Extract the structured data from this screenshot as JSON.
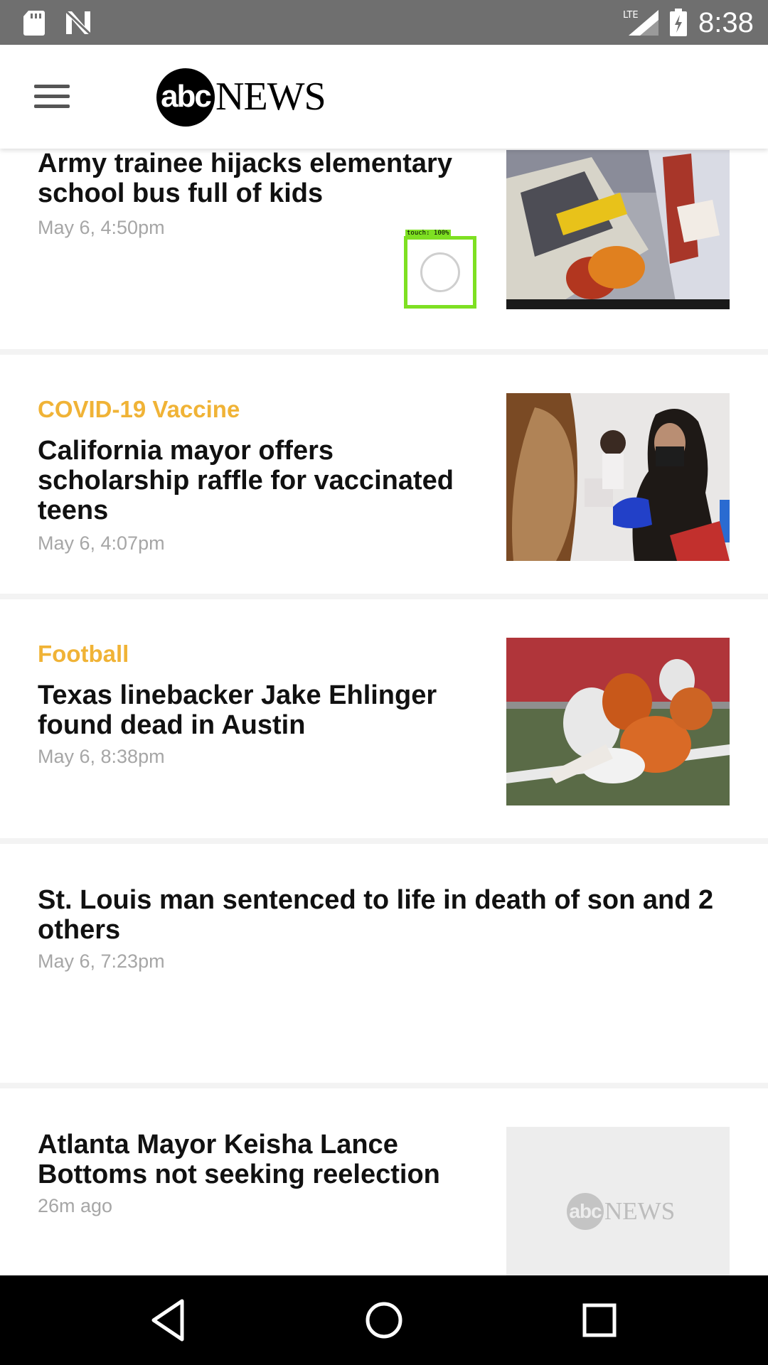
{
  "status_bar": {
    "time": "8:38",
    "network": "LTE",
    "icons": [
      "sd-card-icon",
      "n-notification-icon",
      "lte-signal-icon",
      "battery-charging-icon"
    ]
  },
  "header": {
    "logo_abc": "abc",
    "logo_news": "NEWS",
    "menu_icon": "hamburger-menu-icon"
  },
  "touch_overlay": {
    "label": "touch: 100%"
  },
  "articles": [
    {
      "category": "",
      "headline": "Army trainee hijacks elementary school bus full of kids",
      "timestamp": "May 6, 4:50pm",
      "thumbnail": "school-bus-driver-photo"
    },
    {
      "category": "COVID-19 Vaccine",
      "headline": "California mayor offers scholarship raffle for vaccinated teens",
      "timestamp": "May 6, 4:07pm",
      "thumbnail": "vaccination-photo"
    },
    {
      "category": "Football",
      "headline": "Texas linebacker Jake Ehlinger found dead in Austin",
      "timestamp": "May 6, 8:38pm",
      "thumbnail": "football-game-photo"
    },
    {
      "category": "",
      "headline": "St. Louis man sentenced to life in death of son and 2 others",
      "timestamp": "May 6, 7:23pm",
      "thumbnail": ""
    },
    {
      "category": "",
      "headline": "Atlanta Mayor Keisha Lance Bottoms not seeking reelection",
      "timestamp": "26m ago",
      "thumbnail": "abc-news-placeholder",
      "placeholder_logo_abc": "abc",
      "placeholder_logo_news": "NEWS"
    }
  ],
  "colors": {
    "category": "#f0b336",
    "headline": "#111111",
    "timestamp": "#a6a6a6",
    "status_bar": "#6f6f6f",
    "nav_bar": "#000000"
  },
  "nav_bar": {
    "buttons": [
      "back-icon",
      "home-icon",
      "recents-icon"
    ]
  }
}
